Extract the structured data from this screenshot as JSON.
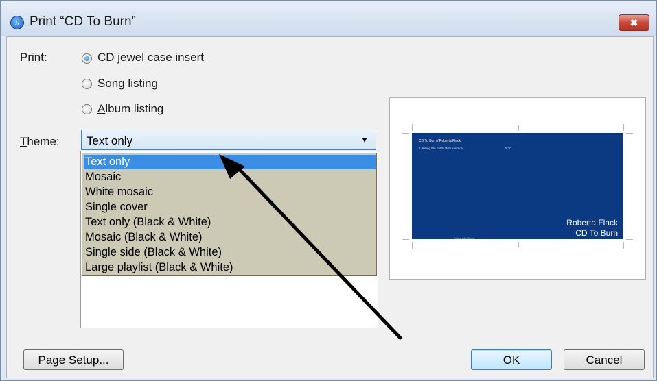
{
  "window": {
    "title": "Print “CD To Burn”",
    "app_icon": "itunes-icon",
    "close_glyph": "✖"
  },
  "print_section": {
    "label": "Print:",
    "options": [
      {
        "label": "CD jewel case insert",
        "selected": true
      },
      {
        "label": "Song listing",
        "selected": false
      },
      {
        "label": "Album listing",
        "selected": false
      }
    ]
  },
  "theme": {
    "label": "Theme:",
    "selected": "Text only",
    "options": [
      "Text only",
      "Mosaic",
      "White mosaic",
      "Single cover",
      "Text only (Black & White)",
      "Mosaic (Black & White)",
      "Single side (Black & White)",
      "Large playlist (Black & White)"
    ]
  },
  "preview": {
    "header": "CD To Burn / Roberta Flack",
    "track": "1. Killing Me Softly With His Son",
    "track_time": "5:20",
    "artist": "Roberta Flack",
    "album": "CD To Burn",
    "footer": "Printed with iTunes",
    "background_color": "#0b3a82"
  },
  "buttons": {
    "page_setup": "Page Setup...",
    "ok": "OK",
    "cancel": "Cancel"
  },
  "colors": {
    "selection": "#3a8ee6",
    "dropdown_bg": "#ccc9b5",
    "close": "#c8493a"
  }
}
